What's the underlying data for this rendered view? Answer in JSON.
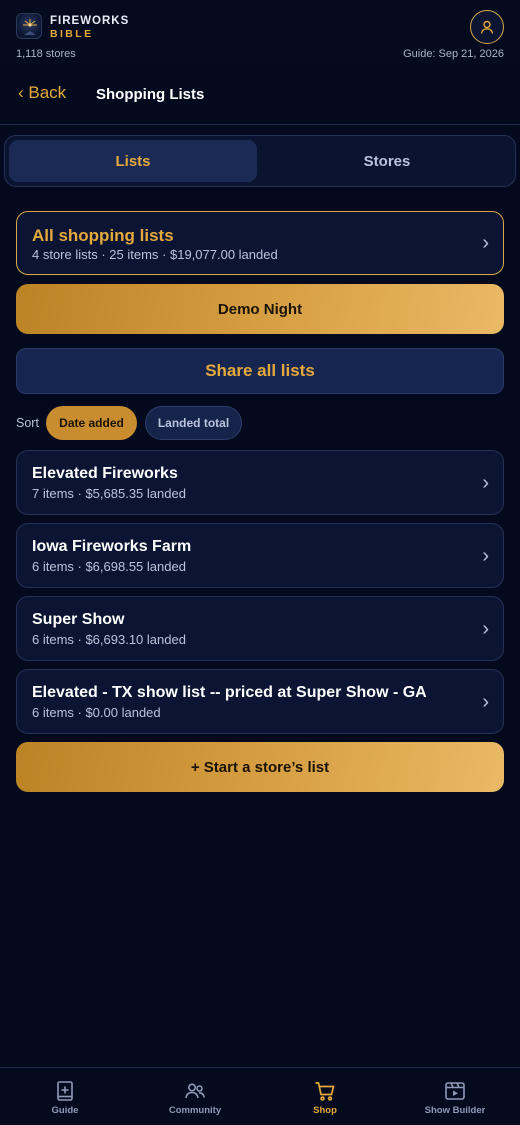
{
  "header": {
    "brand_line1": "FIREWORKS",
    "brand_line2": "BIBLE",
    "store_count": "1,118 stores",
    "guide_date": "Guide: Sep 21, 2026",
    "logo_icon": "fireworks-logo-icon",
    "account_icon": "user-icon"
  },
  "nav": {
    "back_label": "‹ Back",
    "title": "Shopping Lists"
  },
  "tabs": {
    "lists": "Lists",
    "stores": "Stores",
    "active": "Lists"
  },
  "summary": {
    "title": "All shopping lists",
    "subtitle": "4 store lists · 25 items · $19,077.00 landed",
    "chevron": "›"
  },
  "actions": {
    "demo_night": "Demo Night",
    "share_all": "Share all lists",
    "start_list": "+ Start a store’s list"
  },
  "sort": {
    "label": "Sort",
    "options": [
      "Date added",
      "Landed total"
    ],
    "selected": "Date added"
  },
  "store_lists": [
    {
      "name": "Elevated Fireworks",
      "meta": "7 items · $5,685.35 landed",
      "chevron": "›"
    },
    {
      "name": "Iowa Fireworks Farm",
      "meta": "6 items · $6,698.55 landed",
      "chevron": "›"
    },
    {
      "name": "Super Show",
      "meta": "6 items · $6,693.10 landed",
      "chevron": "›"
    },
    {
      "name": "Elevated - TX show list -- priced at Super Show - GA",
      "meta": "6 items · $0.00 landed",
      "chevron": "›"
    }
  ],
  "bottom_nav": [
    {
      "label": "Guide",
      "icon": "book-plus-icon"
    },
    {
      "label": "Community",
      "icon": "users-icon"
    },
    {
      "label": "Shop",
      "icon": "cart-icon",
      "active": true
    },
    {
      "label": "Show Builder",
      "icon": "film-icon"
    }
  ],
  "colors": {
    "background": "#040a1d",
    "accent_gold": "#e5a93b",
    "card": "#0b1533",
    "muted_text": "#b9c3dc"
  }
}
